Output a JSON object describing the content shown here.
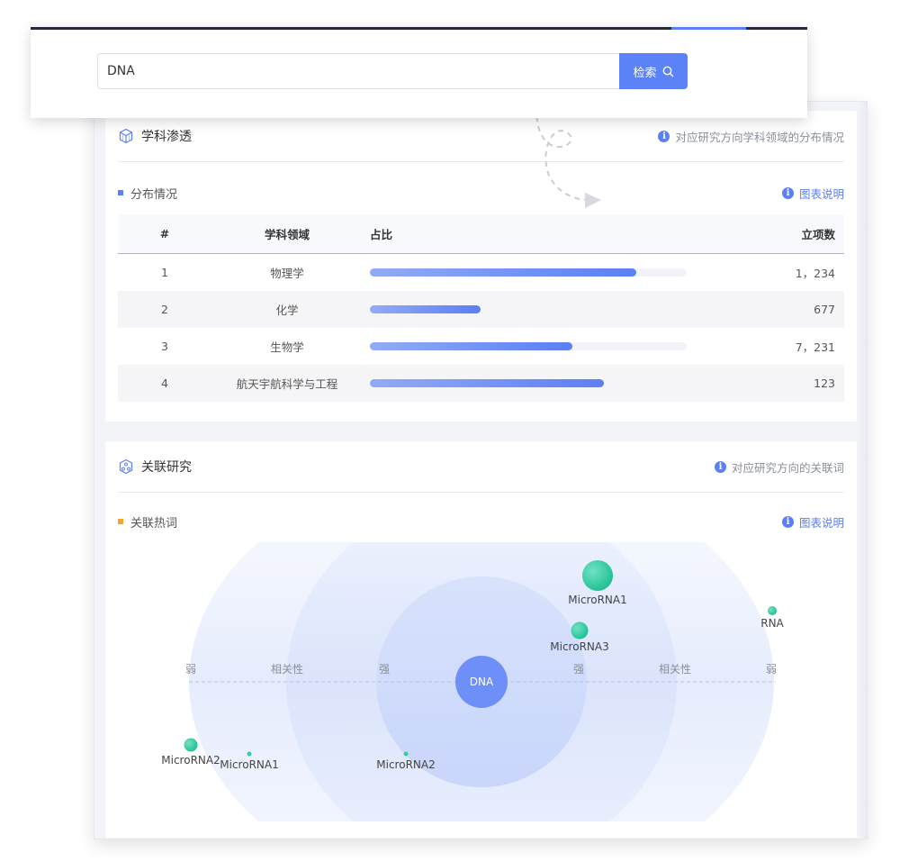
{
  "search": {
    "value": "DNA",
    "button_label": "检索"
  },
  "discipline": {
    "title": "学科渗透",
    "hint": "对应研究方向学科领域的分布情况",
    "subtitle": "分布情况",
    "legend_link": "图表说明",
    "columns": [
      "#",
      "学科领域",
      "占比",
      "立项数"
    ],
    "rows": [
      {
        "idx": "1",
        "field": "物理学",
        "ratio": 0.84,
        "count": "1，234"
      },
      {
        "idx": "2",
        "field": "化学",
        "ratio": 0.35,
        "count": "677"
      },
      {
        "idx": "3",
        "field": "生物学",
        "ratio": 0.64,
        "count": "7，231"
      },
      {
        "idx": "4",
        "field": "航天宇航科学与工程",
        "ratio": 0.74,
        "count": "123"
      }
    ]
  },
  "related": {
    "title": "关联研究",
    "hint": "对应研究方向的关联词",
    "subtitle": "关联热词",
    "legend_link": "图表说明",
    "axis_labels": [
      "弱",
      "相关性",
      "强",
      "强",
      "相关性",
      "弱"
    ],
    "center": "DNA",
    "keywords": [
      "MicroRNA1",
      "MicroRNA3",
      "RNA",
      "MicroRNA2",
      "MicroRNA1",
      "MicroRNA2"
    ]
  },
  "colors": {
    "accent": "#5b7ff5",
    "bubble": "#2fcfa3",
    "orange_mark": "#f5a623"
  }
}
